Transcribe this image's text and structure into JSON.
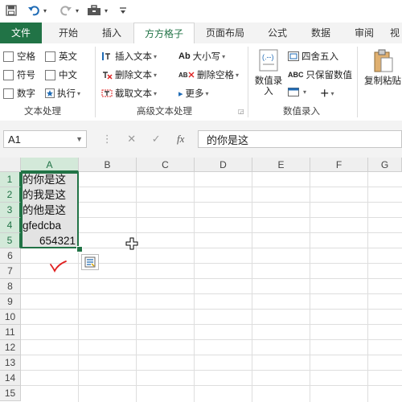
{
  "quick_access": {
    "undo_caret": "▾",
    "redo_caret": "▾",
    "more": "▾"
  },
  "tabs": [
    "文件",
    "开始",
    "插入",
    "方方格子",
    "页面布局",
    "公式",
    "数据",
    "审阅",
    "视"
  ],
  "ribbon": {
    "text_processing": {
      "checks": [
        "空格",
        "英文",
        "符号",
        "中文",
        "数字"
      ],
      "run": "执行",
      "group_label": "文本处理"
    },
    "advanced_text": {
      "insert": "插入文本",
      "delete": "删除文本",
      "extract": "截取文本",
      "case": "大小写",
      "delete_spaces": "删除空格",
      "more": "更多",
      "group_label": "高级文本处理"
    },
    "numeric_entry": {
      "numeric": "数值录入",
      "round": "四舍五入",
      "keep_numeric": "只保留数值",
      "group_label": "数值录入"
    },
    "paste": {
      "label": "复制粘贴"
    }
  },
  "formula_bar": {
    "cell_ref": "A1",
    "cancel": "✕",
    "confirm": "✓",
    "fx": "fx",
    "content": "的你是这"
  },
  "sheet": {
    "columns": [
      "A",
      "B",
      "C",
      "D",
      "E",
      "F",
      "G"
    ],
    "rows": [
      "1",
      "2",
      "3",
      "4",
      "5",
      "6",
      "7",
      "8",
      "9",
      "10",
      "11",
      "12",
      "13",
      "14",
      "15"
    ],
    "cells": [
      "的你是这",
      "的我是这",
      "的他是这",
      "gfedcba",
      "654321"
    ]
  },
  "colors": {
    "excel_green": "#217346",
    "selection_fill": "#e3e3e3",
    "header_selected": "#d3e9d9",
    "annotation_red": "#e02020"
  },
  "icons": [
    "save-icon",
    "undo-icon",
    "redo-icon",
    "briefcase-icon",
    "quick-analysis-icon",
    "move-cursor-icon"
  ]
}
